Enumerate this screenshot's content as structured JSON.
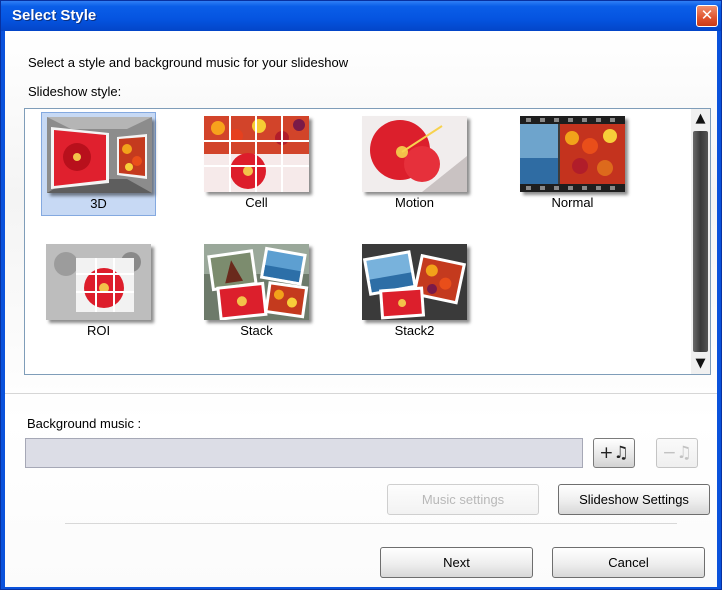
{
  "window": {
    "title": "Select Style",
    "close_glyph": "✕"
  },
  "instruction": "Select a style and background music for your slideshow",
  "slideshow_style_label": "Slideshow style:",
  "styles": [
    {
      "label": "3D",
      "selected": true
    },
    {
      "label": "Cell",
      "selected": false
    },
    {
      "label": "Motion",
      "selected": false
    },
    {
      "label": "Normal",
      "selected": false
    },
    {
      "label": "ROI",
      "selected": false
    },
    {
      "label": "Stack",
      "selected": false
    },
    {
      "label": "Stack2",
      "selected": false
    }
  ],
  "scrollbar": {
    "up_glyph": "▲",
    "down_glyph": "▼"
  },
  "background_music": {
    "label": "Background music :",
    "value": "",
    "add_icon": "add-music-icon",
    "add_glyph": "+♫",
    "remove_icon": "remove-music-icon",
    "remove_glyph": "−♫"
  },
  "buttons": {
    "music_settings": "Music settings",
    "slideshow_settings": "Slideshow Settings",
    "next": "Next",
    "cancel": "Cancel"
  },
  "colors": {
    "titlebar": "#0a5ee8",
    "selection": "#c7d9f4",
    "flower_red": "#d81e2a"
  }
}
